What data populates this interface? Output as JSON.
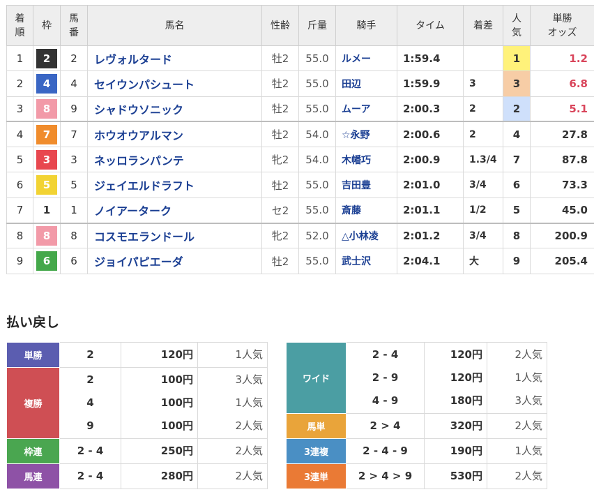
{
  "headers": {
    "rank": [
      "着",
      "順"
    ],
    "waku": "枠",
    "umaban": [
      "馬",
      "番"
    ],
    "name": "馬名",
    "sexage": "性齢",
    "weight": "斤量",
    "jockey": "騎手",
    "time": "タイム",
    "margin": "着差",
    "popularity": [
      "人",
      "気"
    ],
    "odds": [
      "単勝",
      "オッズ"
    ]
  },
  "waku_colors": {
    "1": {
      "bg": "#ffffff",
      "fg": "#333333"
    },
    "2": {
      "bg": "#333333",
      "fg": "#ffffff"
    },
    "3": {
      "bg": "#e8474f",
      "fg": "#ffffff"
    },
    "4": {
      "bg": "#3a66c4",
      "fg": "#ffffff"
    },
    "5": {
      "bg": "#f2d333",
      "fg": "#ffffff"
    },
    "6": {
      "bg": "#44a84a",
      "fg": "#ffffff"
    },
    "7": {
      "bg": "#f08c2c",
      "fg": "#ffffff"
    },
    "8": {
      "bg": "#f29aa8",
      "fg": "#ffffff"
    }
  },
  "results": [
    {
      "rank": "1",
      "waku": "2",
      "umaban": "2",
      "name": "レヴォルタード",
      "sexage": "牡2",
      "weight": "55.0",
      "jockey": "ルメー",
      "time": "1:59.4",
      "margin": "",
      "popularity": "1",
      "odds": "1.2"
    },
    {
      "rank": "2",
      "waku": "4",
      "umaban": "4",
      "name": "セイウンパシュート",
      "sexage": "牡2",
      "weight": "55.0",
      "jockey": "田辺",
      "time": "1:59.9",
      "margin": "3",
      "popularity": "3",
      "odds": "6.8"
    },
    {
      "rank": "3",
      "waku": "8",
      "umaban": "9",
      "name": "シャドウソニック",
      "sexage": "牡2",
      "weight": "55.0",
      "jockey": "ムーア",
      "time": "2:00.3",
      "margin": "2",
      "popularity": "2",
      "odds": "5.1"
    },
    {
      "rank": "4",
      "waku": "7",
      "umaban": "7",
      "name": "ホウオウアルマン",
      "sexage": "牡2",
      "weight": "54.0",
      "jockey": "☆永野",
      "time": "2:00.6",
      "margin": "2",
      "popularity": "4",
      "odds": "27.8"
    },
    {
      "rank": "5",
      "waku": "3",
      "umaban": "3",
      "name": "ネッロランパンテ",
      "sexage": "牝2",
      "weight": "54.0",
      "jockey": "木幡巧",
      "time": "2:00.9",
      "margin": "1.3/4",
      "popularity": "7",
      "odds": "87.8"
    },
    {
      "rank": "6",
      "waku": "5",
      "umaban": "5",
      "name": "ジェイエルドラフト",
      "sexage": "牡2",
      "weight": "55.0",
      "jockey": "吉田豊",
      "time": "2:01.0",
      "margin": "3/4",
      "popularity": "6",
      "odds": "73.3"
    },
    {
      "rank": "7",
      "waku": "1",
      "umaban": "1",
      "name": "ノイアーターク",
      "sexage": "セ2",
      "weight": "55.0",
      "jockey": "斎藤",
      "time": "2:01.1",
      "margin": "1/2",
      "popularity": "5",
      "odds": "45.0"
    },
    {
      "rank": "8",
      "waku": "8",
      "umaban": "8",
      "name": "コスモエランドール",
      "sexage": "牝2",
      "weight": "52.0",
      "jockey": "△小林凌",
      "time": "2:01.2",
      "margin": "3/4",
      "popularity": "8",
      "odds": "200.9"
    },
    {
      "rank": "9",
      "waku": "6",
      "umaban": "6",
      "name": "ジョイパピエーダ",
      "sexage": "牡2",
      "weight": "55.0",
      "jockey": "武士沢",
      "time": "2:04.1",
      "margin": "大",
      "popularity": "9",
      "odds": "205.4"
    }
  ],
  "payout_title": "払い戻し",
  "payouts_left": [
    {
      "type": "単勝",
      "color": "#5b5db0",
      "entries": [
        {
          "nums": "2",
          "yen": "120円",
          "pop": "1人気"
        }
      ]
    },
    {
      "type": "複勝",
      "color": "#cf4f54",
      "entries": [
        {
          "nums": "2",
          "yen": "100円",
          "pop": "3人気"
        },
        {
          "nums": "4",
          "yen": "100円",
          "pop": "1人気"
        },
        {
          "nums": "9",
          "yen": "100円",
          "pop": "2人気"
        }
      ]
    },
    {
      "type": "枠連",
      "color": "#4aa650",
      "entries": [
        {
          "nums": "2 - 4",
          "yen": "250円",
          "pop": "2人気"
        }
      ]
    },
    {
      "type": "馬連",
      "color": "#8e52a6",
      "entries": [
        {
          "nums": "2 - 4",
          "yen": "280円",
          "pop": "2人気"
        }
      ]
    }
  ],
  "payouts_right": [
    {
      "type": "ワイド",
      "color": "#4b9ea3",
      "entries": [
        {
          "nums": "2 - 4",
          "yen": "120円",
          "pop": "2人気"
        },
        {
          "nums": "2 - 9",
          "yen": "120円",
          "pop": "1人気"
        },
        {
          "nums": "4 - 9",
          "yen": "180円",
          "pop": "3人気"
        }
      ]
    },
    {
      "type": "馬単",
      "color": "#e9a43a",
      "entries": [
        {
          "nums": "2 > 4",
          "yen": "320円",
          "pop": "2人気"
        }
      ]
    },
    {
      "type": "3連複",
      "color": "#4a8fc4",
      "entries": [
        {
          "nums": "2 - 4 - 9",
          "yen": "190円",
          "pop": "1人気"
        }
      ]
    },
    {
      "type": "3連単",
      "color": "#ea7a35",
      "entries": [
        {
          "nums": "2 > 4 > 9",
          "yen": "530円",
          "pop": "2人気"
        }
      ]
    }
  ]
}
